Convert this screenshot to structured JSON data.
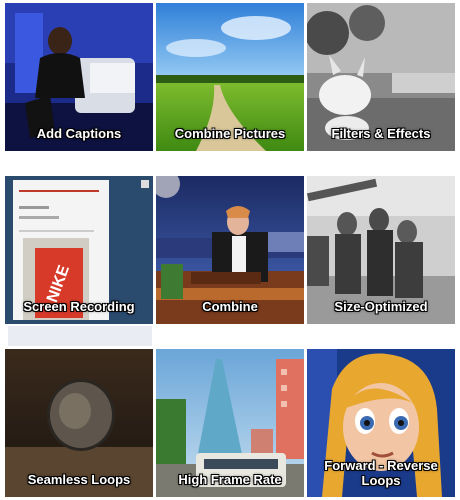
{
  "tiles": [
    {
      "label": "Add Captions"
    },
    {
      "label": "Combine Pictures"
    },
    {
      "label": "Filters & Effects"
    },
    {
      "label": "Screen Recording"
    },
    {
      "label": "Combine"
    },
    {
      "label": "Size-Optimized"
    },
    {
      "label": "Seamless Loops"
    },
    {
      "label": "High Frame Rate"
    },
    {
      "label_line1": "Forward - Reverse",
      "label_line2": "Loops"
    }
  ],
  "colors": {
    "background": "#ffffff",
    "label_text": "#ffffff",
    "label_outline": "#000000"
  }
}
